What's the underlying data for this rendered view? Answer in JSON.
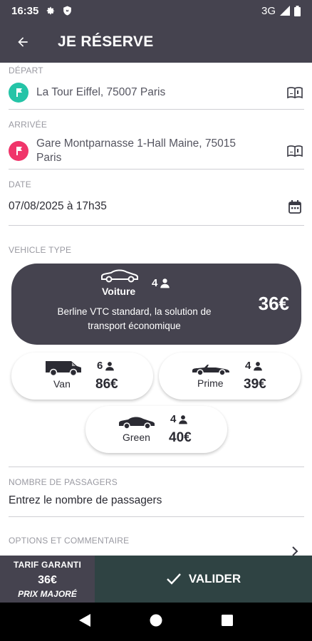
{
  "status_bar": {
    "time": "16:35",
    "network": "3G",
    "icons": [
      "gear-icon",
      "shield-icon",
      "signal-icon",
      "battery-icon"
    ]
  },
  "app_bar": {
    "title": "JE RÉSERVE",
    "back_icon": "arrow-left-icon"
  },
  "form": {
    "depart": {
      "label": "DÉPART",
      "value": "La Tour Eiffel, 75007 Paris",
      "pin_color": "#25c4a7"
    },
    "arrivee": {
      "label": "ARRIVÉE",
      "value_line1": "Gare Montparnasse 1-Hall Maine, 75015",
      "value_line2": "Paris",
      "pin_color": "#f0356a"
    },
    "date": {
      "label": "DATE",
      "value": "07/08/2025 à 17h35"
    },
    "vehicle_type_label": "VEHICLE TYPE",
    "passengers": {
      "label": "NOMBRE DE PASSAGERS",
      "placeholder": "Entrez le nombre de passagers"
    },
    "options": {
      "label": "OPTIONS ET COMMENTAIRE"
    }
  },
  "vehicles": {
    "voiture": {
      "name": "Voiture",
      "seats": "4",
      "description": "Berline VTC standard, la solution de transport économique",
      "price": "36€",
      "selected": true
    },
    "van": {
      "name": "Van",
      "seats": "6",
      "price": "86€"
    },
    "prime": {
      "name": "Prime",
      "seats": "4",
      "price": "39€"
    },
    "green": {
      "name": "Green",
      "seats": "4",
      "price": "40€"
    }
  },
  "bottom": {
    "tarif_label": "TARIF GARANTI",
    "tarif_price": "36€",
    "tarif_note": "PRIX MAJORÉ",
    "validate_label": "VALIDER"
  },
  "colors": {
    "header": "#45434f",
    "validate_bg": "#2f4343",
    "accent_teal": "#25c4a7",
    "accent_pink": "#f0356a"
  }
}
